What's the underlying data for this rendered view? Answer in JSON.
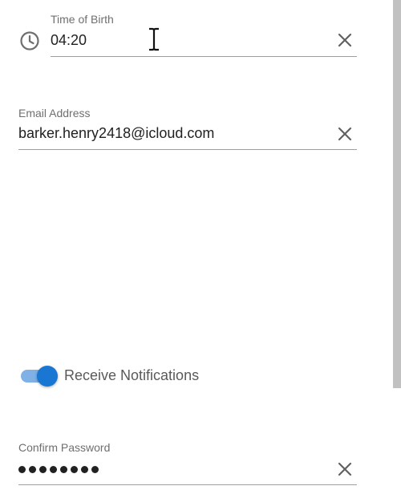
{
  "time_of_birth": {
    "label": "Time of Birth",
    "value": "04:20"
  },
  "email": {
    "label": "Email Address",
    "value": "barker.henry2418@icloud.com"
  },
  "notifications": {
    "label": "Receive Notifications",
    "enabled": true
  },
  "confirm_password": {
    "label": "Confirm Password",
    "masked_length": 8
  },
  "icons": {
    "time": "clock-icon",
    "clear": "close-icon",
    "pointer": "text-cursor-icon"
  },
  "colors": {
    "accent": "#1976d2",
    "accent_track": "#7fb0e6",
    "label": "#6f6f6f",
    "underline": "#9e9e9e",
    "scrollbar": "#c1c1c1"
  }
}
